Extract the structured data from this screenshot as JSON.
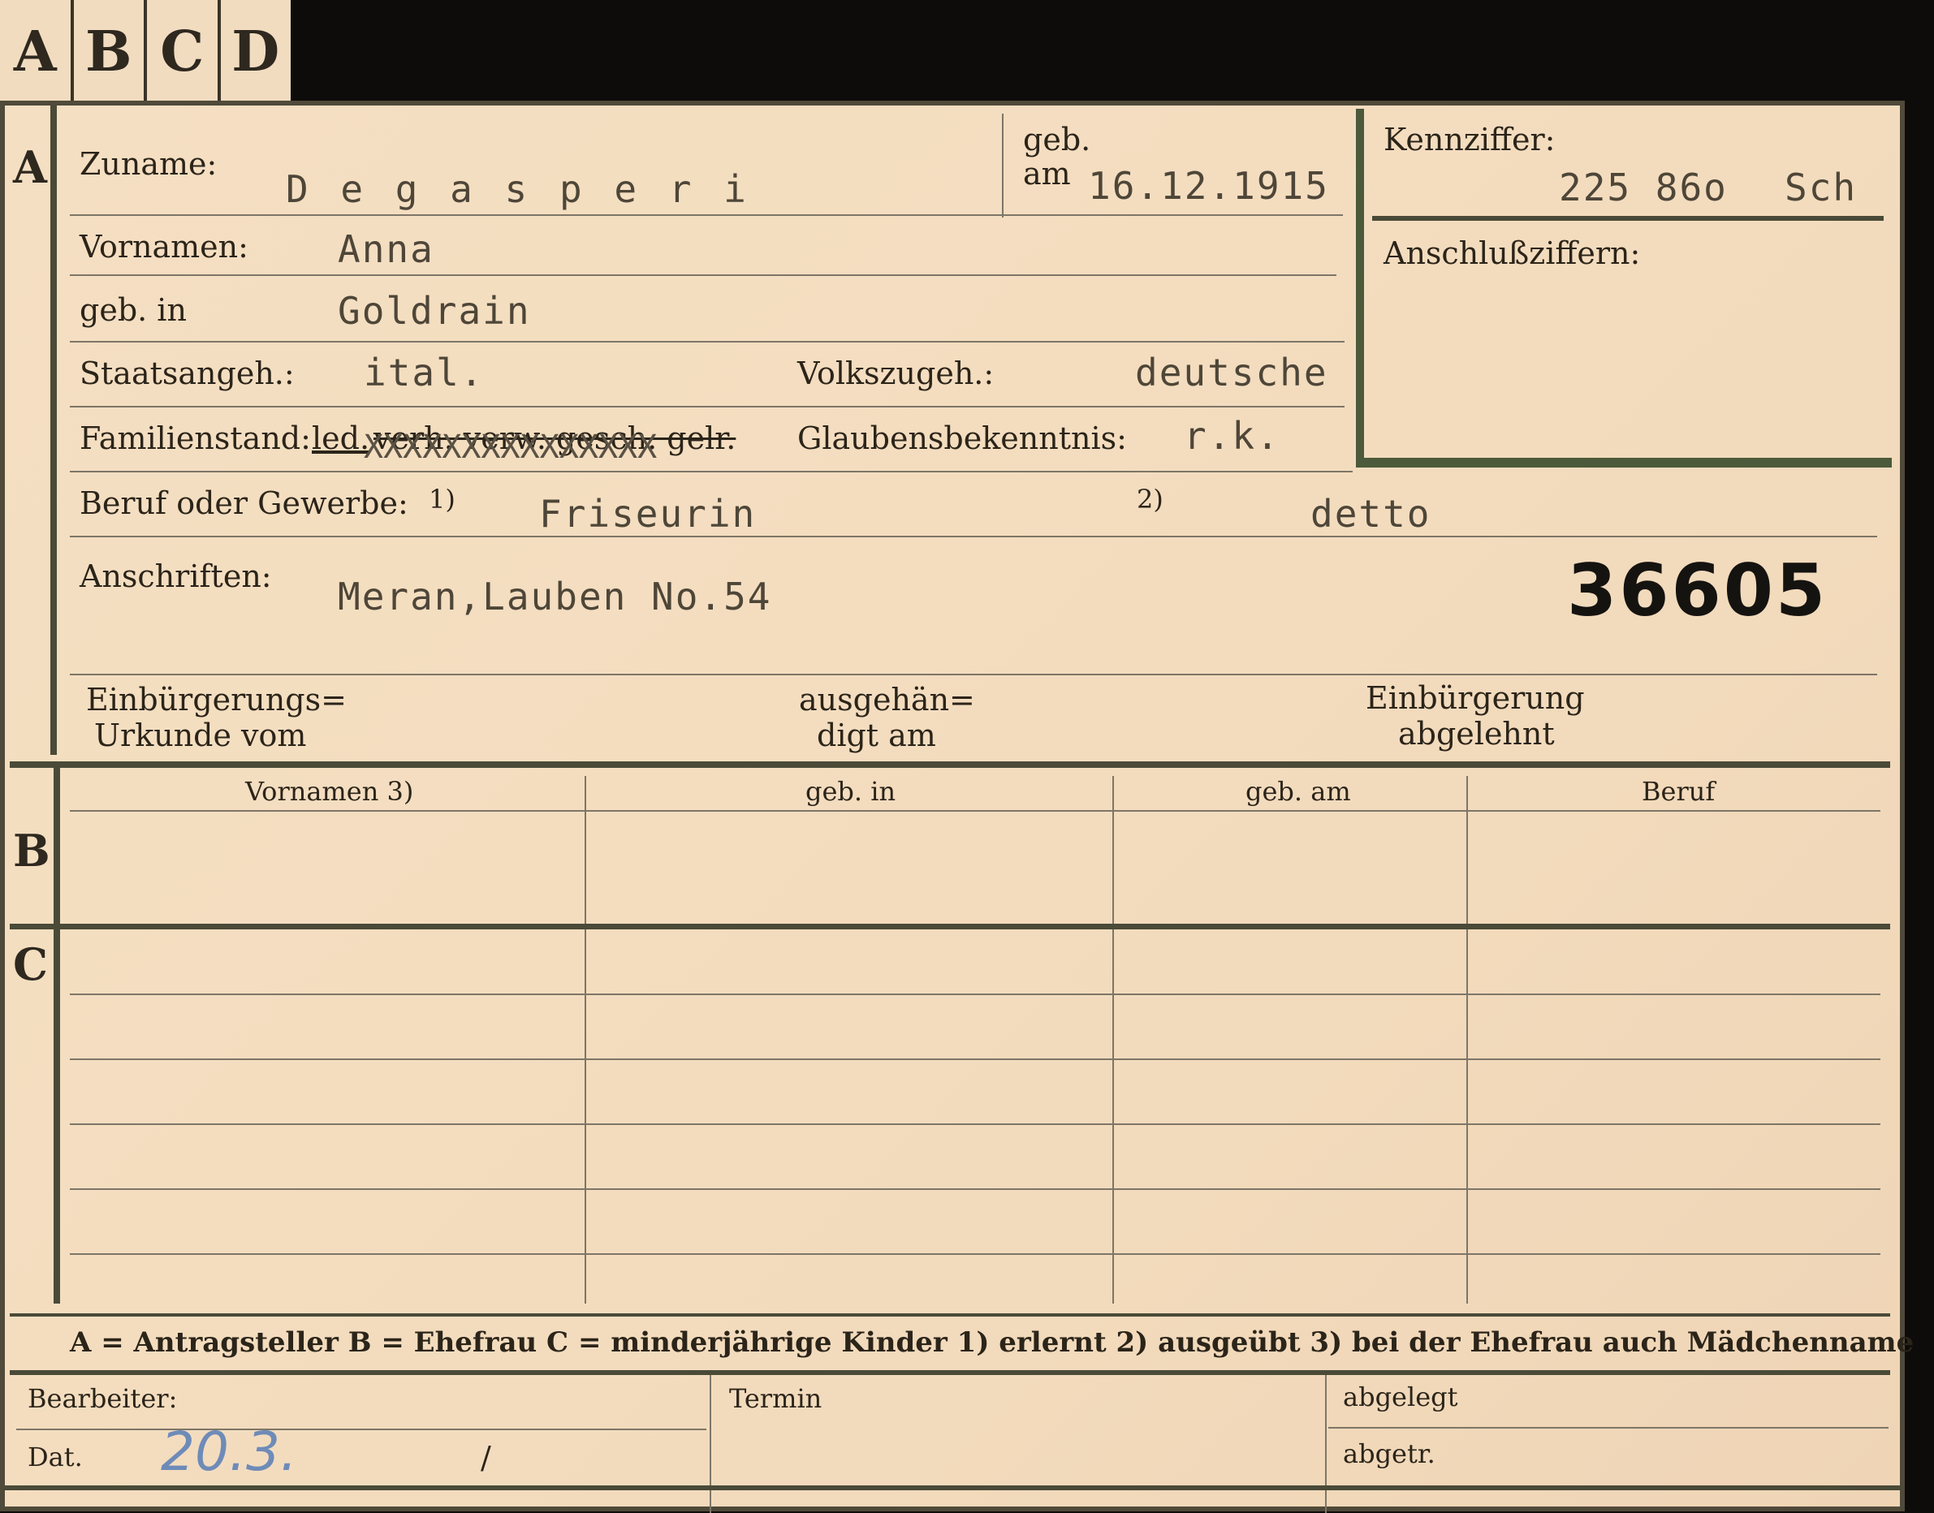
{
  "tabs": [
    "A",
    "B",
    "C",
    "D"
  ],
  "section_letters": {
    "a": "A",
    "b": "B",
    "c": "C"
  },
  "person": {
    "zuname_label": "Zuname:",
    "zuname_value": "D e g a s p e r i",
    "geb_label": "geb.",
    "am_label": "am",
    "geb_am_value": "16.12.1915",
    "vornamen_label": "Vornamen:",
    "vornamen_value": "Anna",
    "geb_in_label": "geb. in",
    "geb_in_value": "Goldrain",
    "staatsangeh_label": "Staatsangeh.:",
    "staatsangeh_value": "ital.",
    "volkszugeh_label": "Volkszugeh.:",
    "volkszugeh_value": "deutsche",
    "familienstand_label": "Familienstand:",
    "familienstand_selected": "led.",
    "familienstand_struck": "verh. verw. gesch. gelr.",
    "familienstand_overtype": "XXXXXXXXXXXXXXX",
    "glaubens_label": "Glaubensbekenntnis:",
    "glaubens_value": "r.k.",
    "beruf_label": "Beruf oder Gewerbe:",
    "beruf_note1": "1)",
    "beruf_value1": "Friseurin",
    "beruf_note2": "2)",
    "beruf_value2": "detto",
    "anschriften_label": "Anschriften:",
    "anschriften_value": "Meran,Lauben No.54",
    "stamp_number": "36605",
    "einbuergerung_l1": "Einbürgerungs=",
    "einbuergerung_l2": "Urkunde vom",
    "ausgehaen_l1": "ausgehän=",
    "ausgehaen_l2": "digt am",
    "abgelehnt_l1": "Einbürgerung",
    "abgelehnt_l2": "abgelehnt"
  },
  "kennziffer": {
    "label": "Kennziffer:",
    "value": "225 86o",
    "suffix": "Sch",
    "anschluss_label": "Anschlußziffern:"
  },
  "table": {
    "headers": [
      "Vornamen 3)",
      "geb. in",
      "geb. am",
      "Beruf"
    ]
  },
  "legend": "A = Antragsteller    B = Ehefrau    C = minderjährige Kinder    1) erlernt    2) ausgeübt    3) bei der Ehefrau auch Mädchenname",
  "footer": {
    "bearbeiter_label": "Bearbeiter:",
    "dat_label": "Dat.",
    "dat_value": "20.3.",
    "dat_slash": "/",
    "termin_label": "Termin",
    "abgelegt_label": "abgelegt",
    "abgetr_label": "abgetr."
  }
}
